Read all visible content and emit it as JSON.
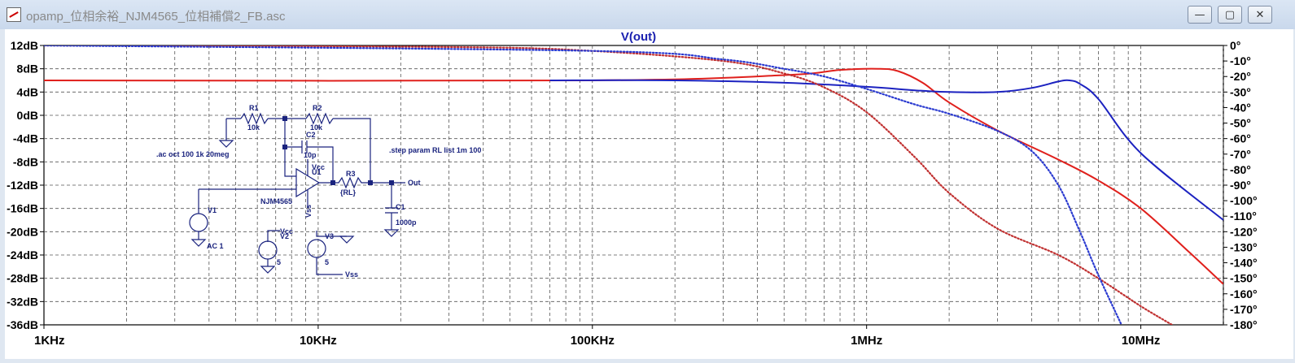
{
  "window": {
    "title": "opamp_位相余裕_NJM4565_位相補償2_FB.asc",
    "minimize_glyph": "—",
    "maximize_glyph": "▢",
    "close_glyph": "✕"
  },
  "schematic": {
    "directive_ac": ".ac oct 100 1k 20meg",
    "directive_step": ".step param RL list 1m 100",
    "labels": [
      {
        "id": "r1",
        "text": "R1"
      },
      {
        "id": "r1v",
        "text": "10k"
      },
      {
        "id": "r2",
        "text": "R2"
      },
      {
        "id": "r2v",
        "text": "10k"
      },
      {
        "id": "c2",
        "text": "C2"
      },
      {
        "id": "c2v",
        "text": "10p"
      },
      {
        "id": "vcc1",
        "text": "Vcc"
      },
      {
        "id": "u1",
        "text": "U1"
      },
      {
        "id": "r3",
        "text": "R3"
      },
      {
        "id": "r3v",
        "text": "{RL}"
      },
      {
        "id": "out",
        "text": "Out"
      },
      {
        "id": "ic",
        "text": "NJM4565"
      },
      {
        "id": "vss1",
        "text": "Vss"
      },
      {
        "id": "v1",
        "text": "V1"
      },
      {
        "id": "c1",
        "text": "C1"
      },
      {
        "id": "c1v",
        "text": "1000p"
      },
      {
        "id": "ac",
        "text": "AC 1"
      },
      {
        "id": "vcc2",
        "text": "Vcc"
      },
      {
        "id": "v2",
        "text": "V2"
      },
      {
        "id": "v3",
        "text": "V3"
      },
      {
        "id": "v2v",
        "text": "5"
      },
      {
        "id": "v3v",
        "text": "5"
      },
      {
        "id": "vss2",
        "text": "Vss"
      }
    ]
  },
  "chart_data": {
    "type": "line",
    "title": "V(out)",
    "x_scale": "log",
    "x_range_hz": [
      1000,
      20000000
    ],
    "x_ticks": [
      {
        "value": 1000,
        "label": "1KHz"
      },
      {
        "value": 10000,
        "label": "10KHz"
      },
      {
        "value": 100000,
        "label": "100KHz"
      },
      {
        "value": 1000000,
        "label": "1MHz"
      },
      {
        "value": 10000000,
        "label": "10MHz"
      }
    ],
    "left_axis": {
      "unit": "dB",
      "range": [
        -36,
        12
      ],
      "ticks": [
        "12dB",
        "8dB",
        "4dB",
        "0dB",
        "-4dB",
        "-8dB",
        "-12dB",
        "-16dB",
        "-20dB",
        "-24dB",
        "-28dB",
        "-32dB",
        "-36dB"
      ]
    },
    "right_axis": {
      "unit": "deg",
      "range": [
        -180,
        0
      ],
      "ticks": [
        "0°",
        "-10°",
        "-20°",
        "-30°",
        "-40°",
        "-50°",
        "-60°",
        "-70°",
        "-80°",
        "-90°",
        "-100°",
        "-110°",
        "-120°",
        "-130°",
        "-140°",
        "-150°",
        "-160°",
        "-170°",
        "-180°"
      ]
    },
    "grid": true,
    "series": [
      {
        "kind": "magnitude",
        "color": "#e0201c",
        "style": "solid",
        "points": [
          [
            1000,
            6
          ],
          [
            100000,
            6
          ],
          [
            500000,
            6.9
          ],
          [
            800000,
            7.8
          ],
          [
            1100000,
            8
          ],
          [
            1300000,
            7.6
          ],
          [
            1600000,
            5.6
          ],
          [
            2000000,
            2.2
          ],
          [
            3000000,
            -2.6
          ],
          [
            5000000,
            -7.6
          ],
          [
            7000000,
            -11.2
          ],
          [
            10000000,
            -16
          ],
          [
            15000000,
            -23.5
          ],
          [
            20000000,
            -29
          ]
        ]
      },
      {
        "kind": "magnitude",
        "color": "#1c22c0",
        "style": "solid",
        "points": [
          [
            70000,
            6
          ],
          [
            200000,
            6
          ],
          [
            500000,
            5.6
          ],
          [
            1000000,
            4.9
          ],
          [
            1500000,
            4.3
          ],
          [
            2000000,
            4
          ],
          [
            3000000,
            4
          ],
          [
            4000000,
            4.7
          ],
          [
            5000000,
            5.8
          ],
          [
            5500000,
            6
          ],
          [
            6000000,
            5.4
          ],
          [
            7000000,
            2.8
          ],
          [
            10000000,
            -6.5
          ],
          [
            20000000,
            -18
          ]
        ]
      },
      {
        "kind": "phase",
        "color": "#c03030",
        "style": "dotted",
        "points": [
          [
            1000,
            0
          ],
          [
            30000,
            -1
          ],
          [
            100000,
            -3.5
          ],
          [
            300000,
            -10
          ],
          [
            500000,
            -18
          ],
          [
            700000,
            -27
          ],
          [
            1000000,
            -43
          ],
          [
            1500000,
            -72
          ],
          [
            2000000,
            -95
          ],
          [
            3000000,
            -118
          ],
          [
            5000000,
            -135
          ],
          [
            7000000,
            -150
          ],
          [
            10000000,
            -168
          ],
          [
            13000000,
            -180
          ]
        ]
      },
      {
        "kind": "phase",
        "color": "#2a3ad0",
        "style": "dotted",
        "points": [
          [
            1000,
            0
          ],
          [
            100000,
            -3.5
          ],
          [
            300000,
            -9
          ],
          [
            500000,
            -15
          ],
          [
            700000,
            -20
          ],
          [
            1000000,
            -28
          ],
          [
            1500000,
            -38
          ],
          [
            2000000,
            -44
          ],
          [
            3000000,
            -55
          ],
          [
            4000000,
            -68
          ],
          [
            5000000,
            -90
          ],
          [
            6000000,
            -120
          ],
          [
            7000000,
            -148
          ],
          [
            8500000,
            -180
          ]
        ]
      }
    ]
  }
}
